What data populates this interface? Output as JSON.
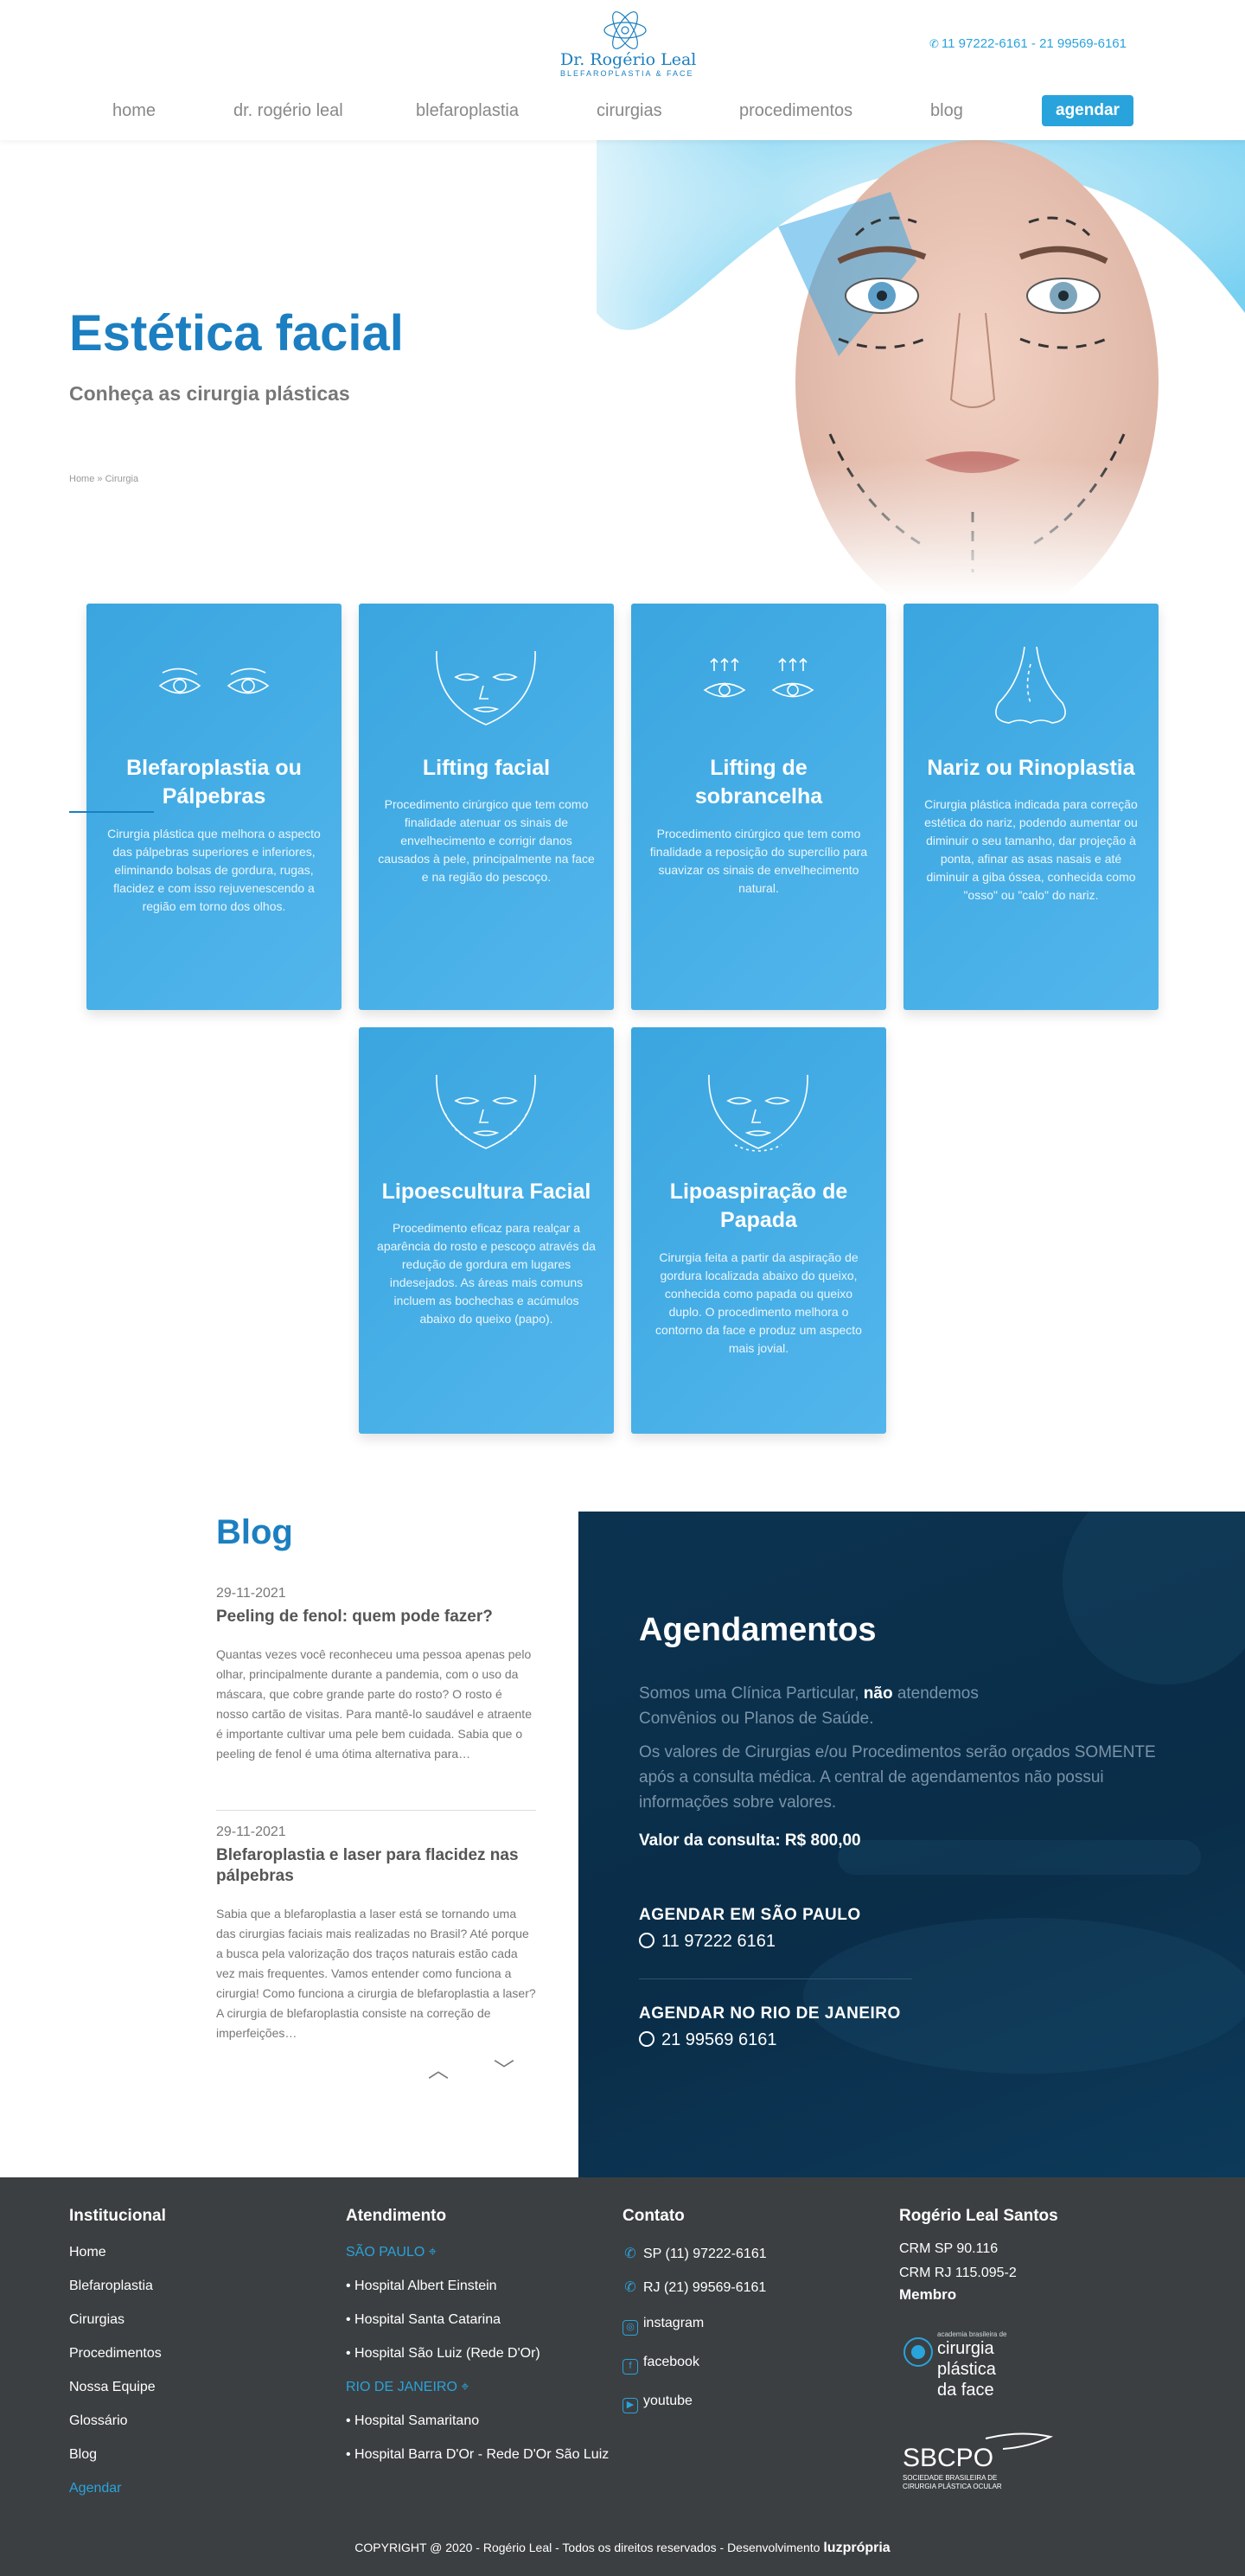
{
  "brand": {
    "name": "Dr. Rogério Leal",
    "tagline": "BLEFAROPLASTIA & FACE",
    "phones": "11 97222-6161 - 21 99569-6161"
  },
  "nav": {
    "items": [
      "home",
      "dr. rogério leal",
      "blefaroplastia",
      "cirurgias",
      "procedimentos",
      "blog"
    ],
    "cta": "agendar"
  },
  "hero": {
    "title": "Estética facial",
    "subtitle": "Conheça as cirurgia plásticas",
    "breadcrumb": "Home » Cirurgia"
  },
  "cards": [
    {
      "title": "Blefaroplastia ou Pálpebras",
      "text": "Cirurgia plástica que melhora o aspecto das pálpebras superiores e inferiores, eliminando bolsas de gordura, rugas, flacidez e com isso rejuvenescendo a região em torno dos olhos.",
      "icon": "eyes-icon"
    },
    {
      "title": "Lifting facial",
      "text": "Procedimento cirúrgico que tem como finalidade atenuar os sinais de envelhecimento e corrigir danos causados à pele, principalmente na face e na região do pescoço.",
      "icon": "face-icon"
    },
    {
      "title": "Lifting de sobrancelha",
      "text": "Procedimento cirúrgico que tem como finalidade a reposição do supercílio para suavizar os sinais de envelhecimento natural.",
      "icon": "eyebrow-lift-icon"
    },
    {
      "title": "Nariz ou Rinoplastia",
      "text": "Cirurgia plástica indicada para correção estética do nariz, podendo aumentar ou diminuir o seu tamanho, dar projeção à ponta, afinar as asas nasais e até diminuir a giba óssea, conhecida como \"osso\" ou \"calo\" do nariz.",
      "icon": "nose-icon"
    },
    {
      "title": "Lipoescultura Facial",
      "text": "Procedimento eficaz para realçar a aparência do rosto e pescoço através da redução de gordura em lugares indesejados. As áreas mais comuns incluem as bochechas e acúmulos abaixo do queixo (papo).",
      "icon": "face-contour-icon"
    },
    {
      "title": "Lipoaspiração de Papada",
      "text": "Cirurgia feita a partir da aspiração de gordura localizada abaixo do queixo, conhecida como papada ou queixo duplo. O procedimento melhora o contorno da face e produz um aspecto mais jovial.",
      "icon": "double-chin-icon"
    }
  ],
  "blog": {
    "title": "Blog",
    "posts": [
      {
        "date": "29-11-2021",
        "title": "Peeling de fenol: quem pode fazer?",
        "excerpt": "Quantas vezes você reconheceu uma pessoa apenas pelo olhar, principalmente durante a pandemia, com o uso da máscara, que cobre grande parte do rosto? O rosto é nosso cartão de visitas. Para mantê-lo saudável e atraente é importante cultivar uma pele bem cuidada. Sabia que o peeling de fenol é uma ótima alternativa para…"
      },
      {
        "date": "29-11-2021",
        "title": "Blefaroplastia e laser para flacidez nas pálpebras",
        "excerpt": "Sabia que a blefaroplastia a laser está se tornando uma das cirurgias faciais mais realizadas no Brasil? Até porque a busca pela valorização dos traços naturais estão cada vez mais frequentes.  Vamos entender como funciona a cirurgia!  Como funciona a cirurgia de blefaroplastia a laser?  A cirurgia de blefaroplastia consiste na correção de imperfeições…"
      }
    ]
  },
  "schedule": {
    "title": "Agendamentos",
    "p1_before": "Somos uma Clínica Particular, ",
    "p1_bold": "não",
    "p1_after": " atendemos Convênios ou Planos de Saúde.",
    "p2": "Os valores de Cirurgias e/ou Procedimentos serão orçados SOMENTE após a consulta médica. A central de agendamentos não possui informações sobre valores.",
    "price": "Valor da consulta: R$ 800,00",
    "sp_label": "AGENDAR EM SÃO PAULO",
    "sp_phone": "11 97222 6161",
    "rj_label": "AGENDAR NO RIO DE JANEIRO",
    "rj_phone": "21 99569 6161"
  },
  "footer": {
    "institucional": {
      "title": "Institucional",
      "items": [
        "Home",
        "Blefaroplastia",
        "Cirurgias",
        "Procedimentos",
        "Nossa Equipe",
        "Glossário",
        "Blog",
        "Agendar"
      ]
    },
    "atendimento": {
      "title": "Atendimento",
      "sp_city": "SÃO PAULO",
      "sp_items": [
        "• Hospital Albert Einstein",
        "• Hospital Santa Catarina",
        "• Hospital São Luiz (Rede D'Or)"
      ],
      "rj_city": "RIO DE JANEIRO",
      "rj_items": [
        "• Hospital Samaritano",
        "• Hospital Barra D'Or - Rede D'Or São Luiz"
      ]
    },
    "contato": {
      "title": "Contato",
      "sp_phone": "SP (11) 97222-6161",
      "rj_phone": "RJ (21) 99569-6161",
      "instagram": "instagram",
      "facebook": "facebook",
      "youtube": "youtube"
    },
    "doctor": {
      "title": "Rogério Leal Santos",
      "crm_sp": "CRM SP 90.116",
      "crm_rj": "CRM RJ 115.095-2",
      "member_label": "Membro",
      "academy_small": "academia brasileira de",
      "academy_l1": "cirurgia",
      "academy_l2": "plástica",
      "academy_l3": "da face",
      "sbcpo": "SBCPO",
      "sbcpo_sub1": "SOCIEDADE BRASILEIRA DE",
      "sbcpo_sub2": "CIRURGIA PLÁSTICA OCULAR"
    },
    "copyright": "COPYRIGHT @ 2020 - Rogério Leal - Todos os direitos reservados - Desenvolvimento",
    "dev": "luzprópria"
  },
  "colors": {
    "brand_blue": "#1b7fc1",
    "accent_blue": "#29a3dc",
    "card_blue": "#3aa5df",
    "schedule_navy": "#0b3350",
    "footer_gray": "#3c3f41"
  }
}
